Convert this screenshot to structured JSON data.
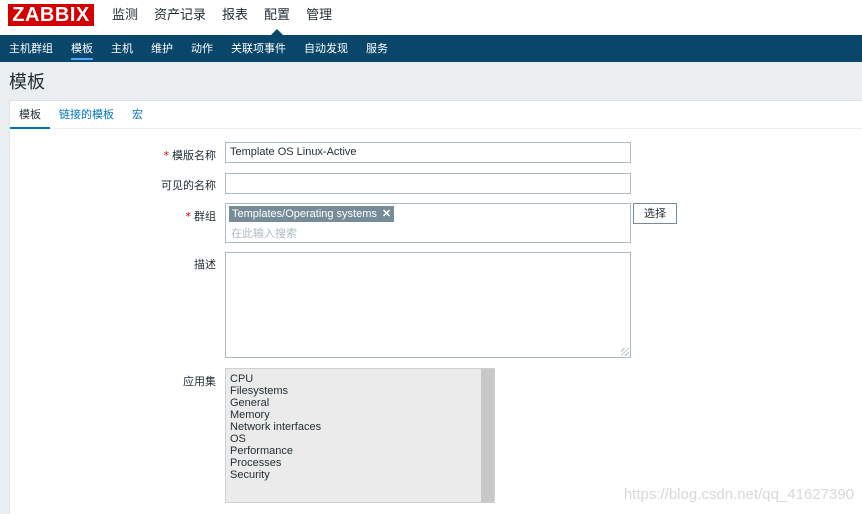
{
  "header": {
    "logo": "ZABBIX",
    "menu": [
      {
        "label": "监测",
        "selected": false
      },
      {
        "label": "资产记录",
        "selected": false
      },
      {
        "label": "报表",
        "selected": false
      },
      {
        "label": "配置",
        "selected": true
      },
      {
        "label": "管理",
        "selected": false
      }
    ]
  },
  "submenu": [
    {
      "label": "主机群组",
      "active": false
    },
    {
      "label": "模板",
      "active": true
    },
    {
      "label": "主机",
      "active": false
    },
    {
      "label": "维护",
      "active": false
    },
    {
      "label": "动作",
      "active": false
    },
    {
      "label": "关联项事件",
      "active": false
    },
    {
      "label": "自动发现",
      "active": false
    },
    {
      "label": "服务",
      "active": false
    }
  ],
  "page_title": "模板",
  "tabs": [
    {
      "label": "模板",
      "active": true
    },
    {
      "label": "链接的模板",
      "active": false
    },
    {
      "label": "宏",
      "active": false
    }
  ],
  "form": {
    "required_mark": "*",
    "template_name_label": "模版名称",
    "template_name_value": "Template OS Linux-Active",
    "visible_name_label": "可见的名称",
    "visible_name_value": "",
    "groups_label": "群组",
    "groups_tag": "Templates/Operating systems",
    "groups_remove_glyph": "✕",
    "groups_placeholder": "在此输入搜索",
    "select_button": "选择",
    "description_label": "描述",
    "description_value": "",
    "applications_label": "应用集",
    "applications": [
      "CPU",
      "Filesystems",
      "General",
      "Memory",
      "Network interfaces",
      "OS",
      "Performance",
      "Processes",
      "Security"
    ]
  },
  "watermark": "https://blog.csdn.net/qq_41627390",
  "colors": {
    "brand": "#d40000",
    "nav": "#0a466a",
    "link": "#0275b8",
    "tag": "#768d99"
  }
}
